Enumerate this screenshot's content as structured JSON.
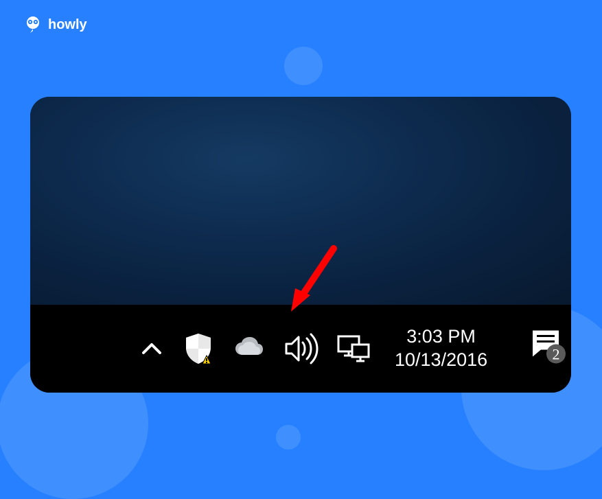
{
  "brand": {
    "name": "howly"
  },
  "taskbar": {
    "clock": {
      "time": "3:03 PM",
      "date": "10/13/2016"
    },
    "action_center_badge": "2",
    "icons": {
      "chevron": "chevron-up-icon",
      "defender": "windows-defender-icon",
      "onedrive": "onedrive-icon",
      "volume": "volume-icon",
      "network": "network-icon",
      "action_center": "action-center-icon"
    }
  }
}
